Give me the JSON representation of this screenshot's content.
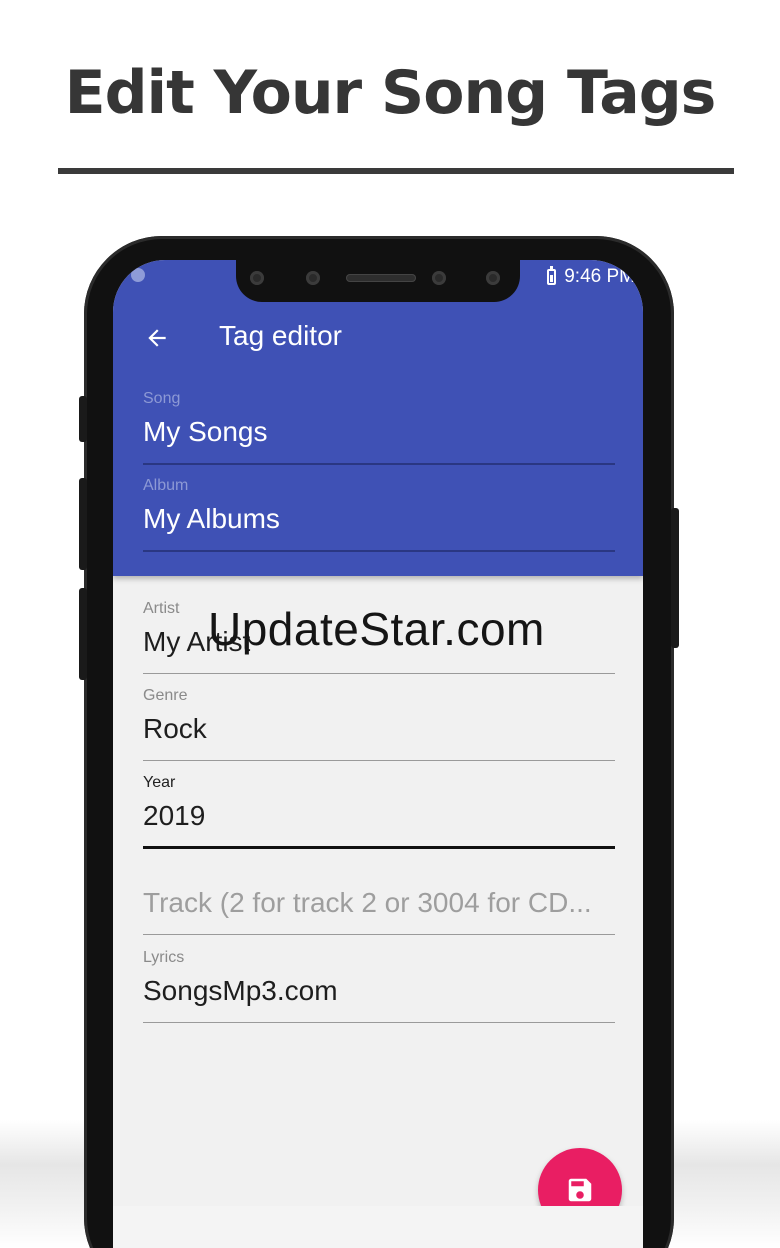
{
  "headline": "Edit Your Song Tags",
  "status_bar": {
    "time": "9:46 PM"
  },
  "app_bar": {
    "title": "Tag editor"
  },
  "fields": {
    "song": {
      "label": "Song",
      "value": "My Songs"
    },
    "album": {
      "label": "Album",
      "value": "My Albums"
    },
    "artist": {
      "label": "Artist",
      "value": "My Artist"
    },
    "genre": {
      "label": "Genre",
      "value": "Rock"
    },
    "year": {
      "label": "Year",
      "value": "2019"
    },
    "track": {
      "placeholder": "Track (2 for track 2 or 3004 for CD..."
    },
    "lyrics": {
      "label": "Lyrics",
      "value": "SongsMp3.com"
    }
  },
  "watermark": "UpdateStar.com",
  "colors": {
    "app_bar": "#3f51b5",
    "fab": "#e91e63",
    "background": "#f1f1f1"
  },
  "icons": {
    "back": "arrow-back-icon",
    "save": "save-icon",
    "battery": "battery-icon"
  }
}
